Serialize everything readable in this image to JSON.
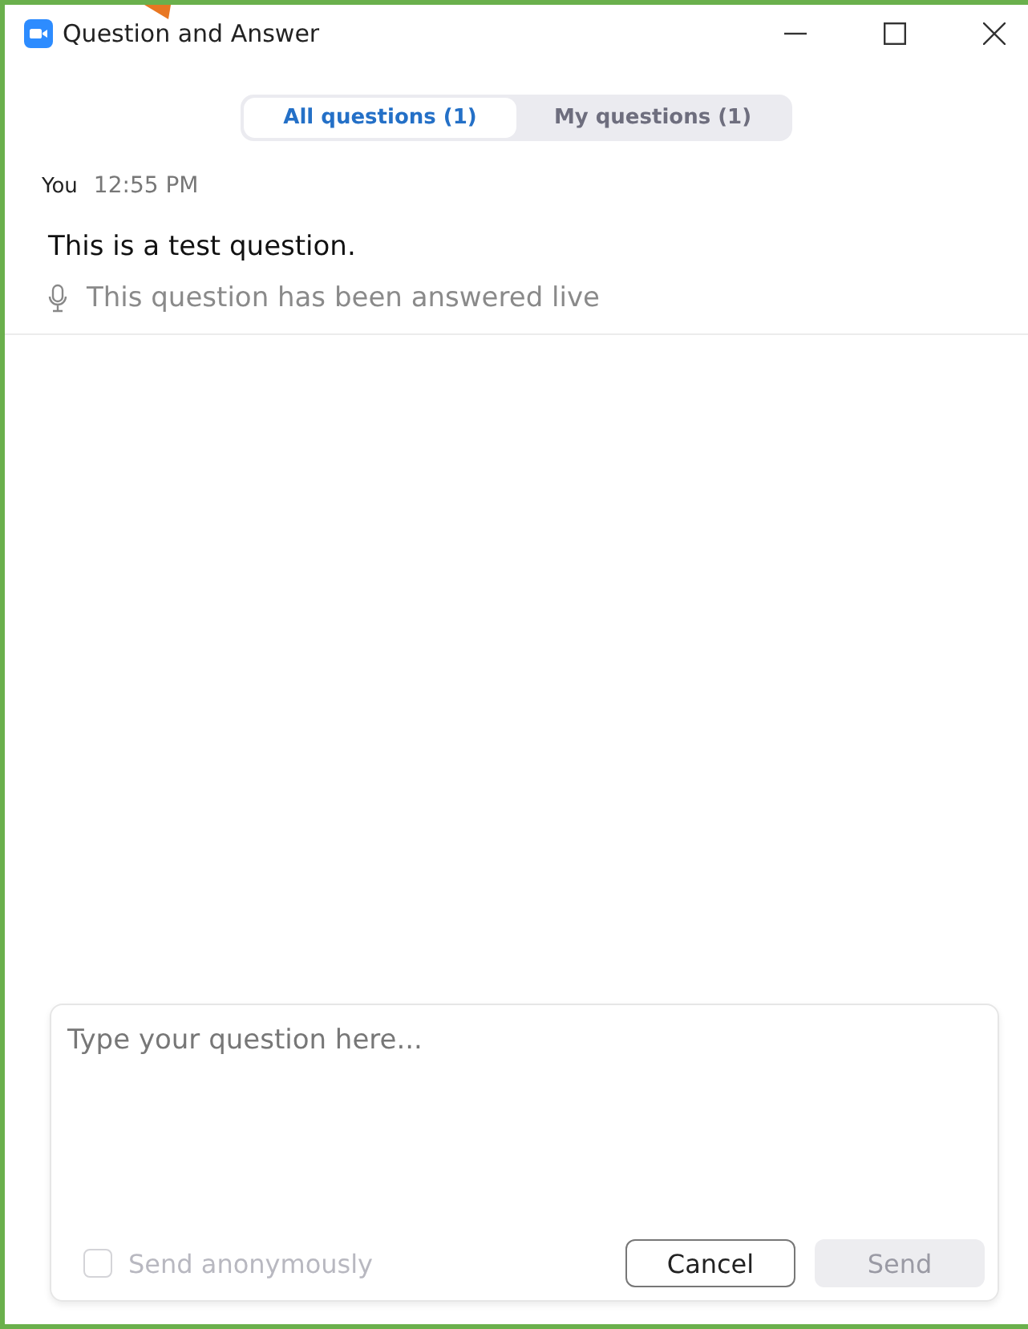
{
  "window": {
    "title": "Question and Answer"
  },
  "tabs": [
    {
      "label": "All questions (1)",
      "selected": true
    },
    {
      "label": "My questions (1)",
      "selected": false
    }
  ],
  "questions": [
    {
      "author": "You",
      "time": "12:55 PM",
      "text": "This is a test question.",
      "status": "This question has been answered live"
    }
  ],
  "composer": {
    "placeholder": "Type your question here...",
    "anonymous": {
      "label": "Send anonymously",
      "checked": false,
      "disabled": true
    },
    "buttons": [
      {
        "label": "Cancel",
        "disabled": false
      },
      {
        "label": "Send",
        "disabled": true
      }
    ]
  }
}
